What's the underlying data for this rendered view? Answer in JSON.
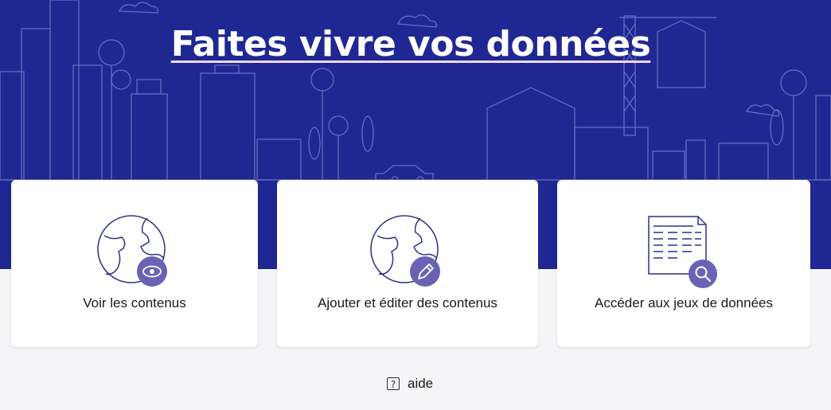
{
  "hero": {
    "title": "Faites vivre vos données"
  },
  "cards": [
    {
      "label": "Voir les contenus",
      "icon": "globe-eye-icon"
    },
    {
      "label": "Ajouter et éditer des contenus",
      "icon": "globe-pencil-icon"
    },
    {
      "label": "Accéder aux jeux de données",
      "icon": "spreadsheet-search-icon"
    }
  ],
  "help": {
    "label": "aide",
    "icon": "question-icon"
  },
  "colors": {
    "hero_bg": "#1f2892",
    "accent": "#6b62b5",
    "underline": "#f3d9e4"
  }
}
